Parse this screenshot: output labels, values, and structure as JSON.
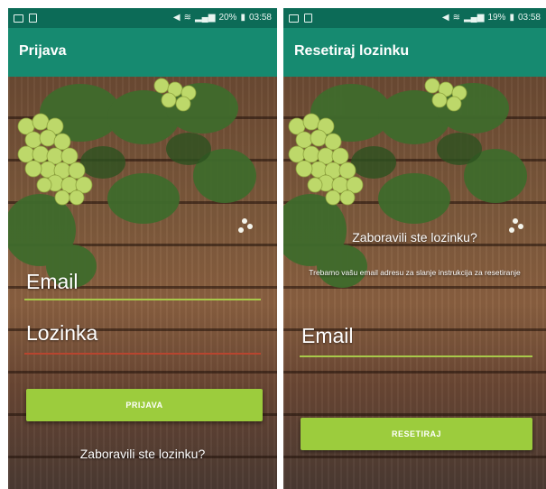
{
  "colors": {
    "status_bar": "#0c6b57",
    "app_bar": "#168a70",
    "button": "#9ccc3d",
    "email_underline": "#a8c94a",
    "password_underline": "#b8452f"
  },
  "left_screen": {
    "status": {
      "left_icons": [
        "image-icon",
        "notification-icon"
      ],
      "battery": "20%",
      "time": "03:58"
    },
    "app_bar_title": "Prijava",
    "email_label": "Email",
    "password_label": "Lozinka",
    "login_button": "PRIJAVA",
    "forgot_link": "Zaboravili ste lozinku?"
  },
  "right_screen": {
    "status": {
      "left_icons": [
        "image-icon",
        "notification-icon"
      ],
      "battery": "19%",
      "time": "03:58"
    },
    "app_bar_title": "Resetiraj lozinku",
    "heading": "Zaboravili ste lozinku?",
    "description": "Trebamo vašu email adresu za slanje instrukcija za resetiranje",
    "email_label": "Email",
    "reset_button": "RESETIRAJ"
  }
}
